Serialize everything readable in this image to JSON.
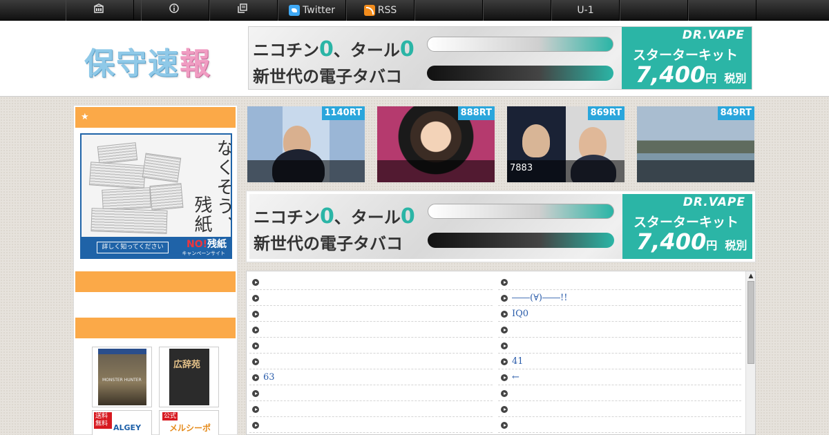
{
  "nav": {
    "items": [
      {
        "icon": "home-icon",
        "label": ""
      },
      {
        "icon": "info-icon",
        "label": ""
      },
      {
        "icon": "archive-icon",
        "label": ""
      },
      {
        "icon": "twitter-icon",
        "label": "Twitter"
      },
      {
        "icon": "rss-icon",
        "label": "RSS"
      },
      {
        "icon": "",
        "label": ""
      },
      {
        "icon": "",
        "label": ""
      },
      {
        "icon": "",
        "label": "U-1"
      },
      {
        "icon": "",
        "label": ""
      },
      {
        "icon": "",
        "label": ""
      }
    ]
  },
  "header": {
    "logo_part1": "保守速",
    "logo_part2": "報"
  },
  "ad": {
    "line1_a": "ニコチン",
    "zero": "0",
    "line1_b": "、タール",
    "line2": "新世代の電子タバコ",
    "brand": "DR.VAPE",
    "starter": "スターターキット",
    "price": "7,400",
    "price_unit": "円",
    "tax": "税別"
  },
  "sidebar": {
    "bar1_label": "★",
    "zanshi": {
      "line1": "なくそう、",
      "line2": "残紙",
      "detail": "詳しく知ってください",
      "no": "NO!",
      "no2": "残紙",
      "site": "キャンペーンサイト"
    },
    "products": [
      {
        "title": "MONSTER HUNTER"
      },
      {
        "title": "広辞苑"
      }
    ],
    "mini": [
      {
        "tag": "送料無料",
        "title": "ALGEY"
      },
      {
        "tag": "公式",
        "title": "メルシーポット"
      }
    ]
  },
  "thumbs": [
    {
      "rt": "1140RT",
      "caption": ""
    },
    {
      "rt": "888RT",
      "caption": ""
    },
    {
      "rt": "869RT",
      "caption": "7883"
    },
    {
      "rt": "849RT",
      "caption": ""
    }
  ],
  "list": {
    "left": [
      "",
      "",
      "",
      "",
      "",
      "",
      "63",
      "",
      "",
      ""
    ],
    "right": [
      "",
      "――(∀)――!!",
      "IQ0",
      "",
      "",
      "41",
      "←",
      "",
      "",
      ""
    ]
  },
  "colors": {
    "accent_orange": "#fba948",
    "accent_teal": "#2bb5a6",
    "rt_blue": "#2aa6dc",
    "link_blue": "#2a5caa"
  }
}
